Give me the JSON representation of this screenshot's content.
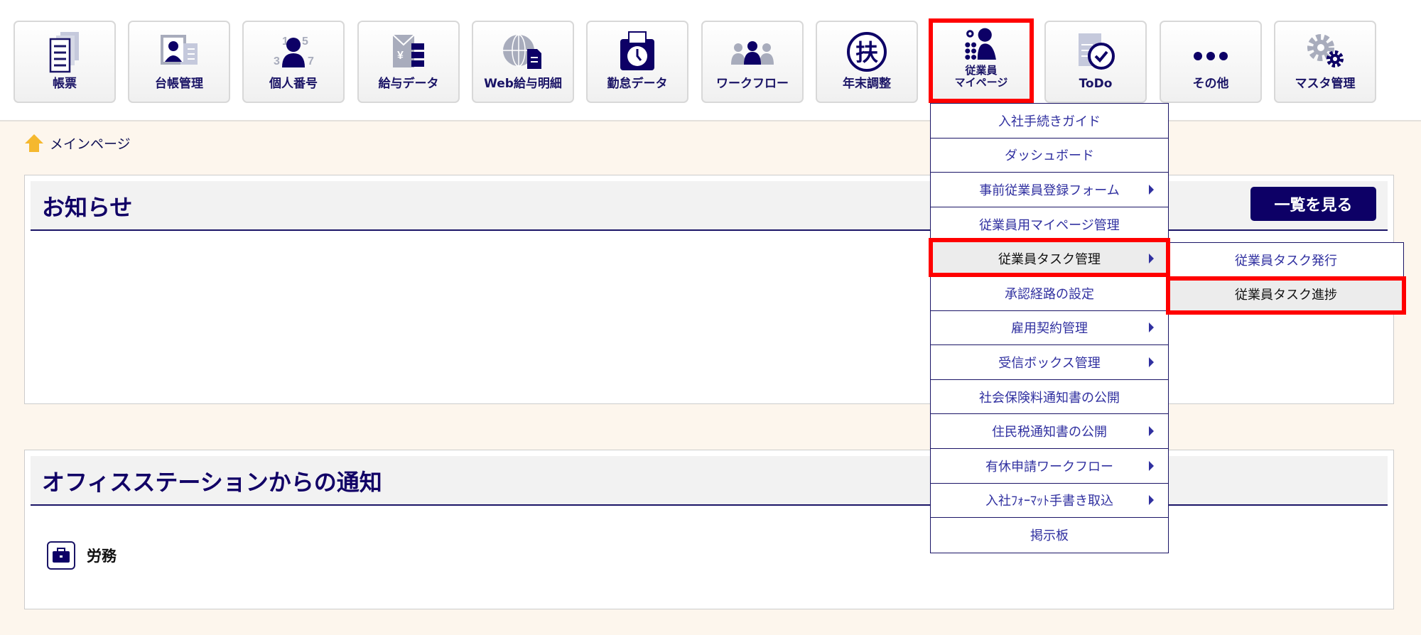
{
  "nav": [
    {
      "label": "帳票",
      "icon": "documents-icon"
    },
    {
      "label": "台帳管理",
      "icon": "id-card-icon"
    },
    {
      "label": "個人番号",
      "icon": "person-numbers-icon"
    },
    {
      "label": "給与データ",
      "icon": "payroll-icon"
    },
    {
      "label": "Web給与明細",
      "icon": "web-document-icon"
    },
    {
      "label": "勤怠データ",
      "icon": "timecard-icon"
    },
    {
      "label": "ワークフロー",
      "icon": "workflow-icon"
    },
    {
      "label": "年末調整",
      "icon": "fu-icon"
    },
    {
      "label": "従業員",
      "label2": "マイページ",
      "icon": "employee-mypage-icon"
    },
    {
      "label": "ToDo",
      "icon": "todo-icon"
    },
    {
      "label": "その他",
      "icon": "more-icon"
    },
    {
      "label": "マスタ管理",
      "icon": "gear-icon"
    }
  ],
  "breadcrumb": "メインページ",
  "notices": {
    "title": "お知らせ",
    "list_button": "一覧を見る"
  },
  "office": {
    "title": "オフィスステーションからの通知",
    "category": "労務"
  },
  "menu": [
    {
      "label": "入社手続きガイド",
      "sub": false
    },
    {
      "label": "ダッシュボード",
      "sub": false
    },
    {
      "label": "事前従業員登録フォーム",
      "sub": true
    },
    {
      "label": "従業員用マイページ管理",
      "sub": false
    },
    {
      "label": "従業員タスク管理",
      "sub": true
    },
    {
      "label": "承認経路の設定",
      "sub": false
    },
    {
      "label": "雇用契約管理",
      "sub": true
    },
    {
      "label": "受信ボックス管理",
      "sub": true
    },
    {
      "label": "社会保険料通知書の公開",
      "sub": false
    },
    {
      "label": "住民税通知書の公開",
      "sub": true
    },
    {
      "label": "有休申請ワークフロー",
      "sub": true
    },
    {
      "label": "入社ﾌｫｰﾏｯﾄ手書き取込",
      "sub": true
    },
    {
      "label": "掲示板",
      "sub": false
    }
  ],
  "submenu": [
    {
      "label": "従業員タスク発行"
    },
    {
      "label": "従業員タスク進捗"
    }
  ],
  "colors": {
    "navy": "#110066",
    "highlight": "#ff0000",
    "cream": "#fdf6ed"
  }
}
